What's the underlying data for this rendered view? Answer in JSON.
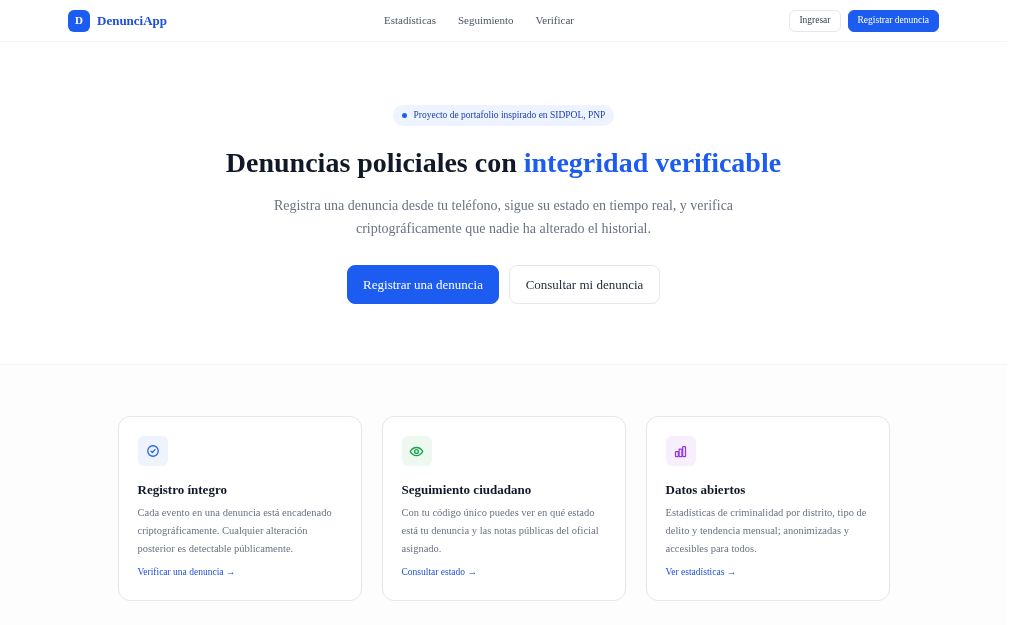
{
  "navbar": {
    "logo": {
      "letter": "D",
      "name": "DenunciApp"
    },
    "links": [
      "Estadísticas",
      "Seguimiento",
      "Verificar"
    ],
    "actions": [
      {
        "label": "Ingresar",
        "kind": "outline"
      },
      {
        "label": "Registrar denuncia",
        "kind": "primary"
      }
    ]
  },
  "hero": {
    "badge": "Proyecto de portafolio inspirado en SIDPOL, PNP",
    "title": "Denuncias policiales con",
    "title_highlight": "integridad verificable",
    "description": "Registra una denuncia desde tu teléfono, sigue su estado en tiempo real, y verifica criptográficamente que nadie ha alterado el historial.",
    "buttons": [
      {
        "label": "Registrar una denuncia",
        "kind": "primary"
      },
      {
        "label": "Consultar mi denuncia",
        "kind": "outline"
      }
    ]
  },
  "features": [
    {
      "kind": "check",
      "color": "#2563eb",
      "title": "Registro íntegro",
      "text": "Cada evento en una denuncia está encadenado criptográficamente. Cualquier alteración posterior es detectable públicamente.",
      "link": "Verificar una denuncia →"
    },
    {
      "kind": "eye",
      "color": "#16a34a",
      "title": "Seguimiento ciudadano",
      "text": "Con tu código único puedes ver en qué estado está tu denuncia y las notas públicas del oficial asignado.",
      "link": "Consultar estado →"
    },
    {
      "kind": "chart",
      "color": "#9333ea",
      "title": "Datos abiertos",
      "text": "Estadísticas de criminalidad por distrito, tipo de delito y tendencia mensual; anonimizadas y accesibles para todos.",
      "link": "Ver estadísticas →"
    }
  ]
}
